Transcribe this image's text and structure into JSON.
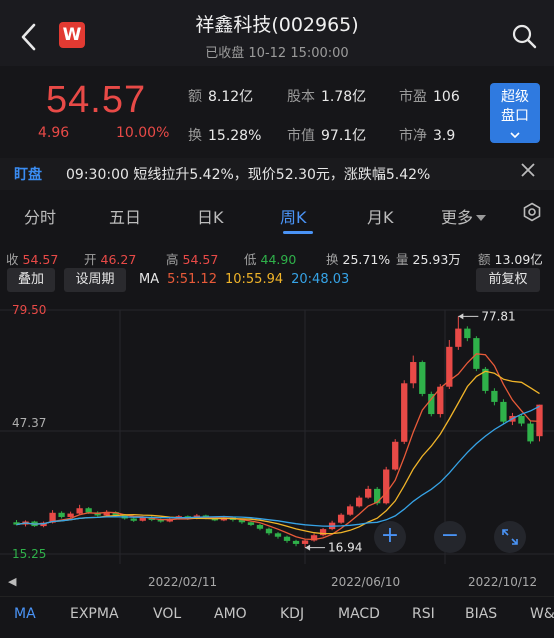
{
  "header": {
    "title": "祥鑫科技(002965)",
    "status": "已收盘 10-12 15:00:00",
    "logo_text": "W"
  },
  "quote": {
    "price": "54.57",
    "change": "4.96",
    "change_pct": "10.00%",
    "stats": [
      {
        "label": "额",
        "value": "8.12亿"
      },
      {
        "label": "股本",
        "value": "1.78亿"
      },
      {
        "label": "市盈",
        "value": "106"
      },
      {
        "label": "换",
        "value": "15.28%"
      },
      {
        "label": "市值",
        "value": "97.1亿"
      },
      {
        "label": "市净",
        "value": "3.9"
      }
    ],
    "super_button": [
      "超级",
      "盘口"
    ],
    "colors": {
      "up": "#e84a47",
      "down": "#2fb14a",
      "accent": "#4a93f5"
    }
  },
  "watch": {
    "tag": "盯盘",
    "text": "09:30:00 短线拉升5.42%，现价52.30元，涨跌幅5.42%"
  },
  "tabs": {
    "items": [
      "分时",
      "五日",
      "日K",
      "周K",
      "月K",
      "更多"
    ],
    "active": "周K"
  },
  "ohlc": {
    "close_label": "收",
    "close": "54.57",
    "open_label": "开",
    "open": "46.27",
    "high_label": "高",
    "high": "54.57",
    "low_label": "低",
    "low": "44.90",
    "turnover_label": "换",
    "turnover": "25.71%",
    "volume_label": "量",
    "volume": "25.93万",
    "amount_label": "额",
    "amount": "13.09亿"
  },
  "controls": {
    "overlay": "叠加",
    "set_period": "设周期",
    "ma_name": "MA",
    "ma5": "5:51.12",
    "ma10": "10:55.94",
    "ma20": "20:48.03",
    "adjust": "前复权"
  },
  "chart_data": {
    "type": "candlestick",
    "y_labels": {
      "top": "79.50",
      "mid": "47.37",
      "bottom": "15.25"
    },
    "x_labels": [
      "2022/02/11",
      "2022/06/10",
      "2022/10/12"
    ],
    "annotations": {
      "max": "77.81",
      "min": "16.94"
    },
    "ylim": [
      15.25,
      79.5
    ],
    "candles": [
      [
        23.6,
        23.0,
        24.2,
        22.8
      ],
      [
        23.0,
        23.8,
        24.1,
        22.5
      ],
      [
        23.8,
        22.6,
        24.0,
        22.4
      ],
      [
        22.6,
        23.5,
        23.8,
        22.3
      ],
      [
        23.5,
        26.1,
        26.8,
        23.3
      ],
      [
        26.1,
        25.0,
        26.5,
        24.6
      ],
      [
        25.0,
        25.9,
        26.4,
        24.8
      ],
      [
        25.9,
        27.3,
        28.2,
        25.7
      ],
      [
        27.3,
        26.2,
        27.6,
        25.8
      ],
      [
        26.2,
        25.4,
        26.5,
        25.1
      ],
      [
        25.4,
        26.3,
        26.8,
        25.2
      ],
      [
        26.3,
        25.4,
        26.5,
        25.0
      ],
      [
        25.4,
        24.6,
        25.8,
        24.3
      ],
      [
        24.6,
        24.0,
        24.9,
        23.7
      ],
      [
        24.0,
        24.9,
        25.2,
        23.8
      ],
      [
        24.9,
        24.2,
        25.3,
        23.9
      ],
      [
        24.2,
        23.8,
        24.6,
        23.5
      ],
      [
        23.8,
        24.5,
        24.9,
        23.6
      ],
      [
        24.5,
        25.2,
        25.5,
        24.3
      ],
      [
        25.2,
        24.6,
        25.4,
        24.2
      ],
      [
        24.6,
        25.4,
        25.8,
        24.4
      ],
      [
        25.4,
        24.7,
        25.6,
        24.4
      ],
      [
        24.7,
        24.1,
        25.0,
        23.9
      ],
      [
        24.1,
        24.9,
        25.3,
        23.9
      ],
      [
        24.9,
        24.2,
        25.1,
        23.8
      ],
      [
        24.2,
        23.6,
        24.4,
        23.2
      ],
      [
        23.6,
        22.9,
        23.8,
        22.6
      ],
      [
        22.9,
        21.9,
        23.2,
        21.5
      ],
      [
        21.9,
        20.7,
        22.2,
        20.2
      ],
      [
        20.7,
        19.8,
        21.0,
        19.3
      ],
      [
        19.8,
        18.7,
        20.1,
        18.2
      ],
      [
        18.7,
        17.9,
        19.0,
        17.3
      ],
      [
        17.9,
        18.8,
        19.2,
        16.94
      ],
      [
        18.8,
        20.2,
        20.6,
        18.5
      ],
      [
        20.2,
        21.8,
        22.1,
        19.9
      ],
      [
        21.8,
        23.5,
        24.0,
        21.5
      ],
      [
        23.5,
        25.6,
        26.0,
        23.2
      ],
      [
        25.6,
        27.8,
        28.3,
        25.3
      ],
      [
        27.8,
        30.1,
        30.6,
        27.5
      ],
      [
        30.1,
        32.4,
        33.2,
        29.8
      ],
      [
        32.4,
        28.6,
        32.9,
        28.1
      ],
      [
        28.6,
        37.5,
        38.2,
        28.3
      ],
      [
        37.5,
        44.8,
        45.5,
        37.2
      ],
      [
        44.8,
        60.2,
        61.0,
        44.2
      ],
      [
        60.2,
        65.8,
        67.5,
        58.9
      ],
      [
        65.8,
        57.4,
        66.2,
        56.8
      ],
      [
        57.4,
        52.1,
        58.0,
        51.5
      ],
      [
        52.1,
        59.3,
        60.0,
        51.2
      ],
      [
        59.3,
        69.8,
        71.6,
        58.7
      ],
      [
        69.8,
        74.6,
        77.81,
        69.0
      ],
      [
        74.6,
        72.1,
        75.2,
        71.3
      ],
      [
        72.1,
        64.0,
        72.6,
        63.4
      ],
      [
        64.0,
        58.2,
        64.5,
        57.5
      ],
      [
        58.2,
        55.3,
        58.9,
        54.4
      ],
      [
        55.3,
        50.1,
        56.0,
        49.5
      ],
      [
        50.1,
        51.6,
        52.4,
        49.2
      ],
      [
        51.6,
        49.6,
        52.0,
        48.9
      ],
      [
        49.6,
        44.9,
        50.2,
        44.3
      ],
      [
        46.27,
        54.57,
        54.57,
        44.9
      ]
    ],
    "ma5_last": 51.12,
    "ma10_last": 55.94,
    "ma20_last": 48.03
  },
  "indicators": {
    "items": [
      "MA",
      "EXPMA",
      "VOL",
      "AMO",
      "KDJ",
      "MACD",
      "RSI",
      "BIAS",
      "W&"
    ],
    "active": "MA"
  }
}
